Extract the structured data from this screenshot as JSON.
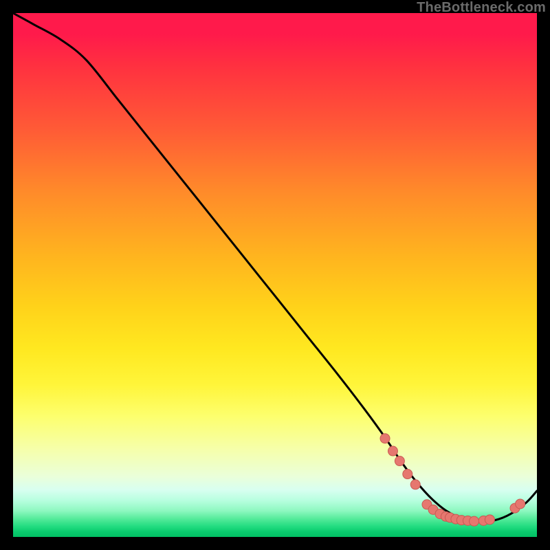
{
  "watermark": "TheBottleneck.com",
  "colors": {
    "page_bg": "#000000",
    "curve": "#000000",
    "marker_fill": "#e6776f",
    "marker_stroke": "#c85a52",
    "gradient_top": "#ff1a4b",
    "gradient_bottom": "#02c064"
  },
  "chart_data": {
    "type": "line",
    "title": "",
    "xlabel": "",
    "ylabel": "",
    "xlim": [
      0,
      100
    ],
    "ylim": [
      0,
      100
    ],
    "grid": false,
    "series": [
      {
        "name": "curve",
        "x": [
          0,
          4,
          9,
          14,
          20,
          26,
          32,
          38,
          44,
          50,
          56,
          62,
          67,
          71,
          74,
          77,
          80,
          83,
          86,
          89,
          92,
          95,
          98,
          100
        ],
        "y": [
          100,
          97.8,
          95.0,
          91.0,
          83.5,
          76.0,
          68.5,
          61.0,
          53.5,
          46.0,
          38.5,
          31.0,
          24.5,
          19.0,
          14.5,
          10.5,
          7.2,
          4.8,
          3.4,
          3.0,
          3.2,
          4.4,
          6.6,
          8.8
        ]
      }
    ],
    "markers": [
      {
        "x": 71.0,
        "y": 18.8
      },
      {
        "x": 72.5,
        "y": 16.4
      },
      {
        "x": 73.8,
        "y": 14.5
      },
      {
        "x": 75.3,
        "y": 12.0
      },
      {
        "x": 76.8,
        "y": 10.0
      },
      {
        "x": 79.0,
        "y": 6.2
      },
      {
        "x": 80.2,
        "y": 5.2
      },
      {
        "x": 81.5,
        "y": 4.4
      },
      {
        "x": 82.6,
        "y": 3.9
      },
      {
        "x": 83.4,
        "y": 3.7
      },
      {
        "x": 84.5,
        "y": 3.4
      },
      {
        "x": 85.6,
        "y": 3.2
      },
      {
        "x": 86.8,
        "y": 3.1
      },
      {
        "x": 88.0,
        "y": 3.0
      },
      {
        "x": 89.8,
        "y": 3.1
      },
      {
        "x": 91.0,
        "y": 3.3
      },
      {
        "x": 95.8,
        "y": 5.5
      },
      {
        "x": 96.8,
        "y": 6.3
      }
    ],
    "marker_radius_px": 7
  }
}
